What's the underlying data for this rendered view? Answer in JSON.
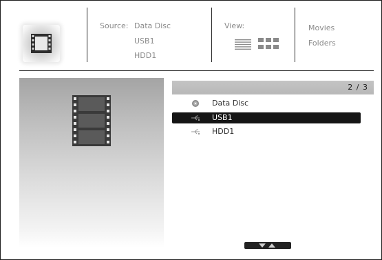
{
  "header": {
    "source_label": "Source:",
    "sources": [
      "Data Disc",
      "USB1",
      "HDD1"
    ],
    "view_label": "View:",
    "modes": [
      "Movies",
      "Folders"
    ]
  },
  "list": {
    "page_indicator": "2 / 3",
    "items": [
      {
        "label": "Data Disc",
        "icon": "disc-icon",
        "selected": false
      },
      {
        "label": "USB1",
        "icon": "usb-icon",
        "selected": true
      },
      {
        "label": "HDD1",
        "icon": "usb-icon",
        "selected": false
      }
    ]
  }
}
